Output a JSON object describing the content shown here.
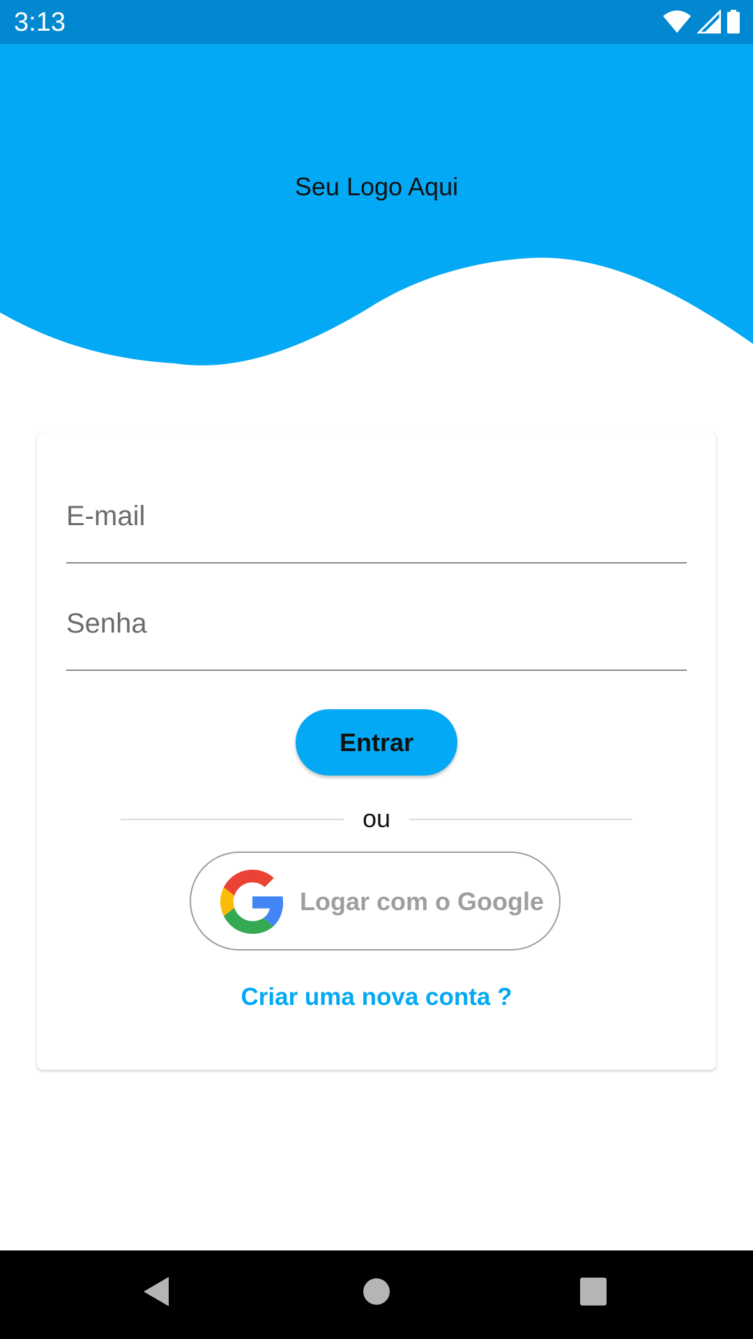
{
  "status_bar": {
    "time": "3:13",
    "icons": [
      "wifi-icon",
      "cell-signal-icon",
      "battery-icon"
    ]
  },
  "header": {
    "logo_text": "Seu Logo Aqui",
    "background_color": "#03a9f4"
  },
  "login_card": {
    "email_placeholder": "E-mail",
    "password_placeholder": "Senha",
    "submit_label": "Entrar",
    "divider_text": "ou",
    "google_button_label": "Logar com o Google",
    "create_account_link": "Criar uma nova conta ?"
  },
  "colors": {
    "accent": "#03a9f4",
    "status_bar": "#0288d1",
    "link": "#03a9f4"
  },
  "nav_bar": {
    "buttons": [
      "back-icon",
      "home-icon",
      "recents-icon"
    ]
  }
}
